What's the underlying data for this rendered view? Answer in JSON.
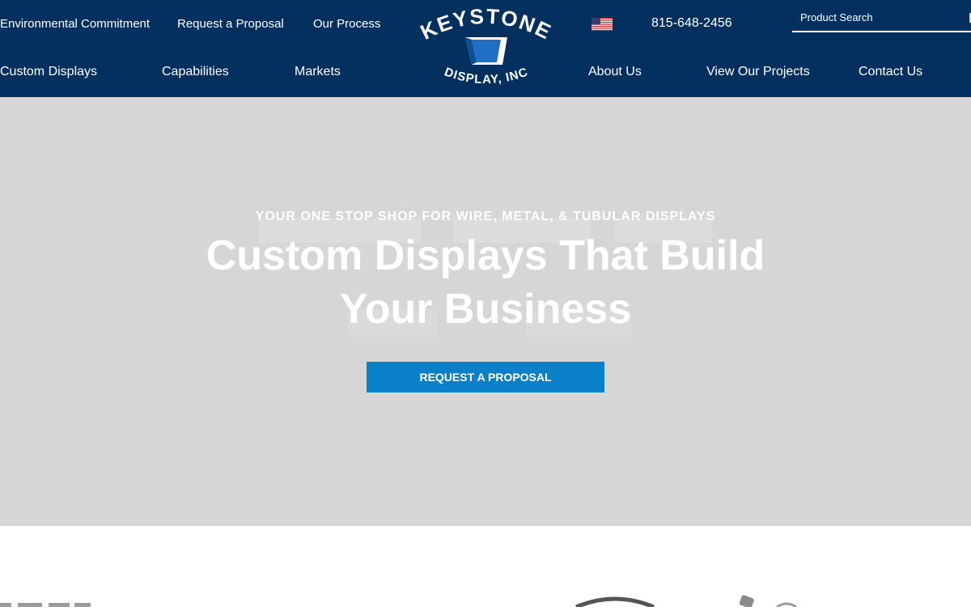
{
  "header": {
    "top_links": [
      "Environmental Commitment",
      "Request a Proposal",
      "Our Process"
    ],
    "phone": "815-648-2456",
    "flag_icon": "us-flag-icon",
    "search": {
      "placeholder": "Product Search"
    },
    "logo": {
      "top_text": "KEYSTONE",
      "bottom_text": "DISPLAY, INC"
    },
    "nav_left": [
      "Custom Displays",
      "Capabilities",
      "Markets"
    ],
    "nav_right": [
      "About Us",
      "View Our Projects",
      "Contact Us"
    ]
  },
  "hero": {
    "eyebrow": "YOUR ONE STOP SHOP FOR WIRE, METAL, & TUBULAR DISPLAYS",
    "title": "Custom Displays That Build Your Business",
    "cta_label": "REQUEST A PROPOSAL"
  },
  "colors": {
    "header_bg": "#03305e",
    "hero_bg": "#d6d6d6",
    "cta_bg": "#0a80c8"
  }
}
